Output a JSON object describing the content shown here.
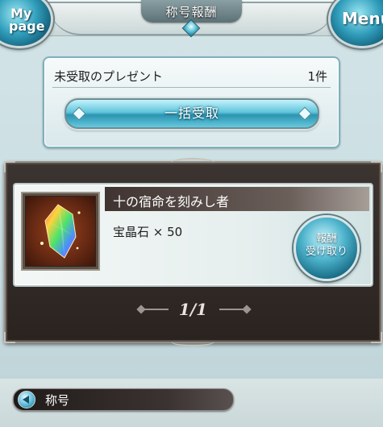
{
  "header": {
    "title": "称号報酬",
    "mypage_line1": "My",
    "mypage_line2": "page",
    "menu_label": "Menu"
  },
  "present": {
    "label": "未受取のプレゼント",
    "count": "1件",
    "bulk_button": "一括受取"
  },
  "reward": {
    "title": "十の宿命を刻みし者",
    "item": "宝晶石 × 50",
    "receive_line1": "報酬",
    "receive_line2": "受け取り"
  },
  "pager": {
    "text": "1/1"
  },
  "footer": {
    "back_label": "称号"
  }
}
